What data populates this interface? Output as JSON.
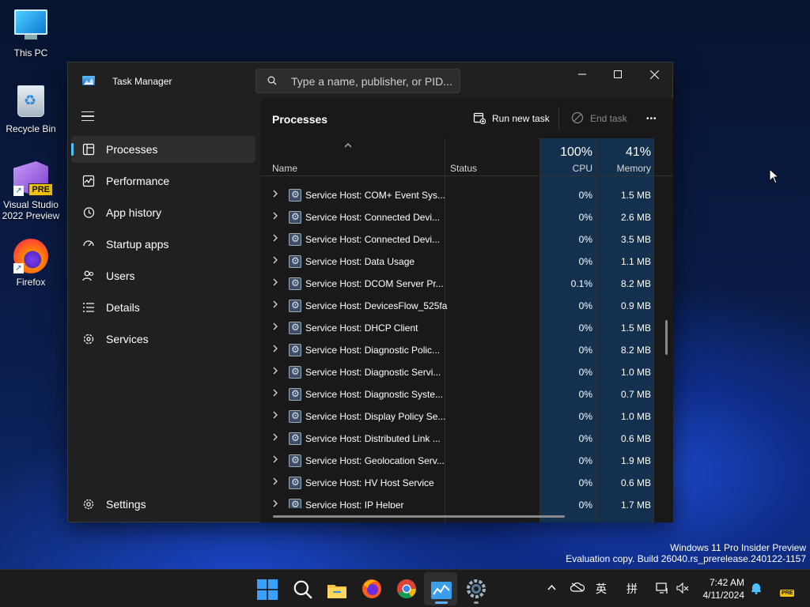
{
  "desktop": {
    "icons": [
      {
        "label": "This PC"
      },
      {
        "label": "Recycle Bin"
      },
      {
        "label": "Visual Studio 2022 Preview",
        "badge": "PRE"
      },
      {
        "label": "Firefox"
      }
    ]
  },
  "window": {
    "title": "Task Manager",
    "search_placeholder": "Type a name, publisher, or PID...",
    "controls": {
      "minimize": "—",
      "maximize": "☐",
      "close": "✕"
    }
  },
  "sidebar": {
    "items": [
      {
        "label": "Processes",
        "icon": "processes-icon",
        "active": true
      },
      {
        "label": "Performance",
        "icon": "performance-icon"
      },
      {
        "label": "App history",
        "icon": "app-history-icon"
      },
      {
        "label": "Startup apps",
        "icon": "startup-apps-icon"
      },
      {
        "label": "Users",
        "icon": "users-icon"
      },
      {
        "label": "Details",
        "icon": "details-icon"
      },
      {
        "label": "Services",
        "icon": "services-icon"
      }
    ],
    "settings_label": "Settings"
  },
  "content": {
    "title": "Processes",
    "run_new_task": "Run new task",
    "end_task": "End task",
    "more": "•••"
  },
  "table": {
    "headers": {
      "name": "Name",
      "status": "Status",
      "cpu_percent": "100%",
      "cpu": "CPU",
      "memory_percent": "41%",
      "memory": "Memory"
    },
    "rows": [
      {
        "name": "Service Host: COM+ Event Sys...",
        "cpu": "0%",
        "mem": "1.5 MB"
      },
      {
        "name": "Service Host: Connected Devi...",
        "cpu": "0%",
        "mem": "2.6 MB"
      },
      {
        "name": "Service Host: Connected Devi...",
        "cpu": "0%",
        "mem": "3.5 MB"
      },
      {
        "name": "Service Host: Data Usage",
        "cpu": "0%",
        "mem": "1.1 MB"
      },
      {
        "name": "Service Host: DCOM Server Pr...",
        "cpu": "0.1%",
        "mem": "8.2 MB"
      },
      {
        "name": "Service Host: DevicesFlow_525fa",
        "cpu": "0%",
        "mem": "0.9 MB"
      },
      {
        "name": "Service Host: DHCP Client",
        "cpu": "0%",
        "mem": "1.5 MB"
      },
      {
        "name": "Service Host: Diagnostic Polic...",
        "cpu": "0%",
        "mem": "8.2 MB"
      },
      {
        "name": "Service Host: Diagnostic Servi...",
        "cpu": "0%",
        "mem": "1.0 MB"
      },
      {
        "name": "Service Host: Diagnostic Syste...",
        "cpu": "0%",
        "mem": "0.7 MB"
      },
      {
        "name": "Service Host: Display Policy Se...",
        "cpu": "0%",
        "mem": "1.0 MB"
      },
      {
        "name": "Service Host: Distributed Link ...",
        "cpu": "0%",
        "mem": "0.6 MB"
      },
      {
        "name": "Service Host: Geolocation Serv...",
        "cpu": "0%",
        "mem": "1.9 MB"
      },
      {
        "name": "Service Host: HV Host Service",
        "cpu": "0%",
        "mem": "0.6 MB"
      },
      {
        "name": "Service Host: IP Helper",
        "cpu": "0%",
        "mem": "1.7 MB"
      }
    ]
  },
  "watermark": {
    "line1": "Windows 11 Pro Insider Preview",
    "line2": "Evaluation copy. Build 26040.rs_prerelease.240122-1157"
  },
  "taskbar": {
    "tray": {
      "ime1": "英",
      "ime2": "拼"
    },
    "time": "7:42 AM",
    "date": "4/11/2024",
    "pre_badge": "PRE"
  }
}
